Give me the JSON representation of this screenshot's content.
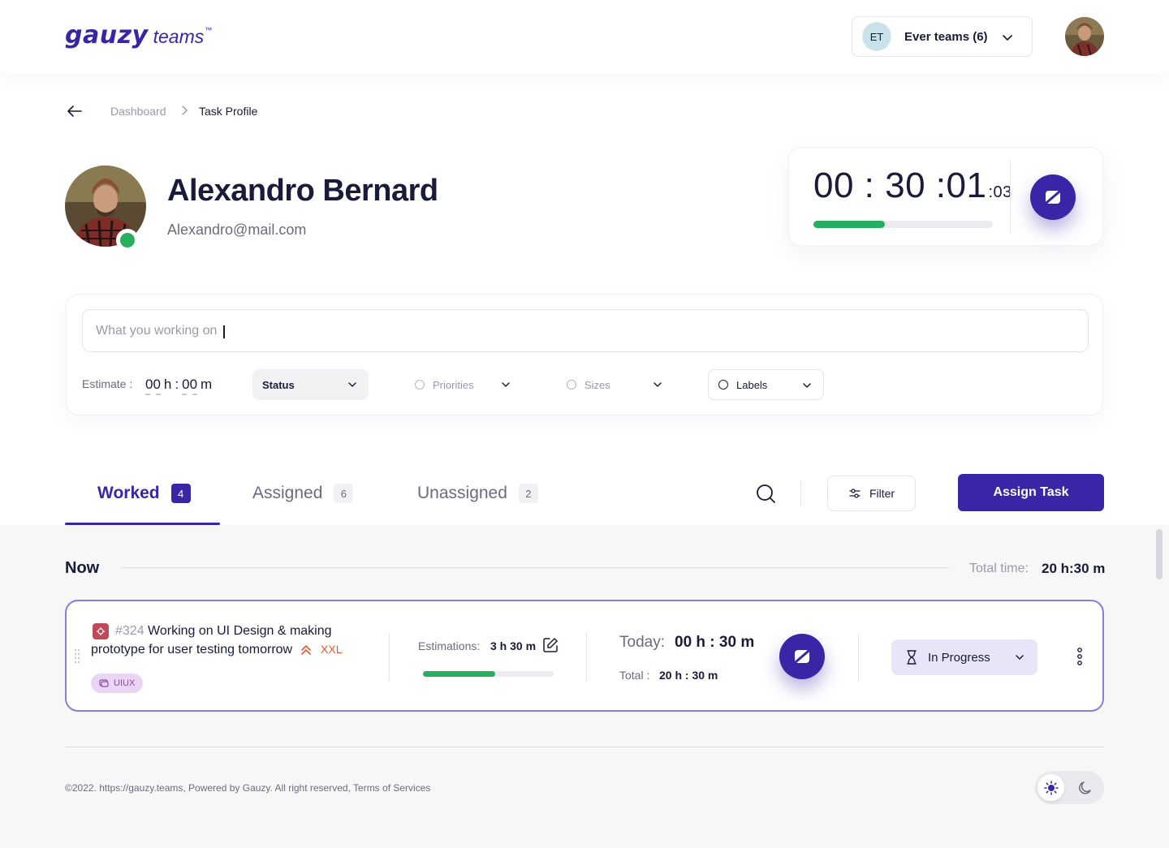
{
  "header": {
    "logo_main": "gauzy",
    "logo_sub": "teams",
    "logo_tm": "™",
    "team": {
      "initials": "ET",
      "name": "Ever teams (6)"
    }
  },
  "breadcrumb": {
    "parent": "Dashboard",
    "current": "Task Profile"
  },
  "profile": {
    "name": "Alexandro Bernard",
    "email": "Alexandro@mail.com",
    "online": true
  },
  "timer": {
    "main": "00 : 30 :01",
    "ms": ":03",
    "progress": 0.4
  },
  "task_form": {
    "placeholder": "What you working on",
    "estimate_label": "Estimate :",
    "estimate_hours": "00",
    "estimate_h_unit": "h",
    "estimate_colon": ":",
    "estimate_minutes": "00",
    "estimate_m_unit": "m",
    "status_label": "Status",
    "priorities_label": "Priorities",
    "sizes_label": "Sizes",
    "labels_label": "Labels"
  },
  "tabs": [
    {
      "label": "Worked",
      "count": "4",
      "active": true
    },
    {
      "label": "Assigned",
      "count": "6",
      "active": false
    },
    {
      "label": "Unassigned",
      "count": "2",
      "active": false
    }
  ],
  "toolbar": {
    "filter_label": "Filter",
    "assign_label": "Assign Task"
  },
  "section": {
    "title": "Now",
    "total_label": "Total time:",
    "total_value": "20 h:30 m"
  },
  "task_row": {
    "number": "#324",
    "title": "Working on UI Design & making prototype for user testing tomorrow",
    "size": "XXL",
    "label": "UIUX",
    "estimations_label": "Estimations:",
    "estimations_value": "3 h 30 m",
    "estimation_progress": 0.55,
    "today_label": "Today:",
    "today_value": "00 h : 30 m",
    "total_label": "Total :",
    "total_value": "20 h : 30 m",
    "status": "In Progress"
  },
  "footer": {
    "text": "©2022. https://gauzy.teams, Powered by Gauzy. All right reserved, Terms of Services"
  },
  "colors": {
    "primary": "#3826a6",
    "success": "#27ae60",
    "size_tag": "#e5572f",
    "active_border": "#8c7ae4"
  }
}
